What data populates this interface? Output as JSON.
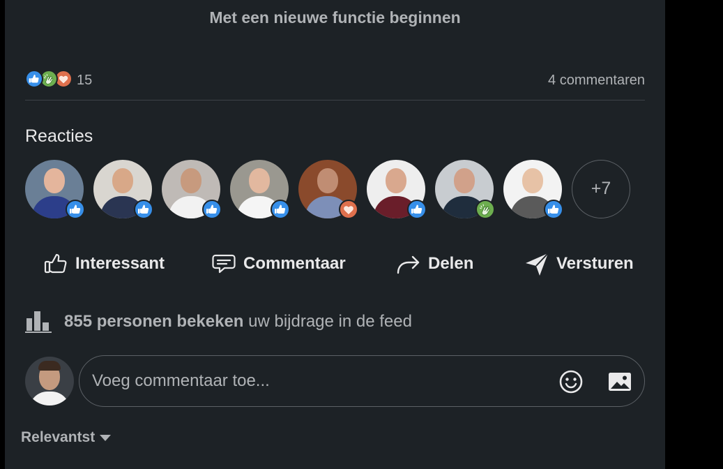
{
  "post": {
    "top_link": "Met een nieuwe functie beginnen"
  },
  "social": {
    "reaction_count": "15",
    "comment_count": "4 commentaren",
    "summary_icons": [
      "like-icon",
      "celebrate-icon",
      "love-icon"
    ]
  },
  "reactions": {
    "title": "Reacties",
    "more_label": "+7",
    "people": [
      {
        "reaction": "like",
        "tone": "#6a7f96",
        "skin": "#e4b59c",
        "shirt": "#2c3e8a"
      },
      {
        "reaction": "like",
        "tone": "#d9d6d0",
        "skin": "#d8a888",
        "shirt": "#2a3552"
      },
      {
        "reaction": "like",
        "tone": "#bfbab6",
        "skin": "#c79a7e",
        "shirt": "#f2f2f2"
      },
      {
        "reaction": "like",
        "tone": "#9a9890",
        "skin": "#e2b89f",
        "shirt": "#f5f5f5"
      },
      {
        "reaction": "love",
        "tone": "#8a4a2c",
        "skin": "#c08d73",
        "shirt": "#7d8fb8"
      },
      {
        "reaction": "like",
        "tone": "#eeeeee",
        "skin": "#d9a88e",
        "shirt": "#6a1e2a"
      },
      {
        "reaction": "celebrate",
        "tone": "#c8ccd0",
        "skin": "#d1a18a",
        "shirt": "#1f2d3d"
      },
      {
        "reaction": "like",
        "tone": "#f3f3f3",
        "skin": "#e7c2a6",
        "shirt": "#5a5a5a"
      }
    ]
  },
  "actions": {
    "like": "Interessant",
    "comment": "Commentaar",
    "share": "Delen",
    "send": "Versturen"
  },
  "views": {
    "count_text": "855 personen bekeken",
    "suffix": " uw bijdrage in de feed"
  },
  "composer": {
    "placeholder": "Voeg commentaar toe..."
  },
  "sort": {
    "label": "Relevantst"
  },
  "colors": {
    "card_bg": "#1d2226",
    "like": "#378fe9",
    "celebrate": "#6dae4f",
    "love": "#df704d",
    "text_primary": "#e9e9ea",
    "text_secondary": "#b0b3b6"
  }
}
